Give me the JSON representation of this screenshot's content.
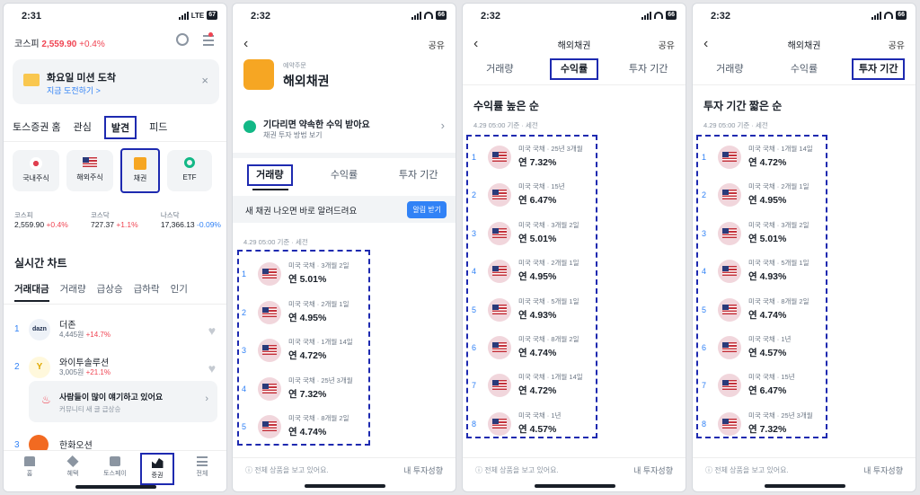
{
  "screen1": {
    "time": "2:31",
    "battery": "67",
    "kospi_label": "코스피",
    "kospi_value": "2,559.90",
    "kospi_change": "+0.4%",
    "mission_title": "화요일 미션 도착",
    "mission_link": "지금 도전하기 >",
    "mission_close": "×",
    "tabs": [
      "토스증권 홈",
      "관심",
      "발견",
      "피드"
    ],
    "categories": [
      {
        "label": "국내주식",
        "icon": "korea-flag-icon"
      },
      {
        "label": "해외주식",
        "icon": "us-flag-icon"
      },
      {
        "label": "채권",
        "icon": "bond-icon"
      },
      {
        "label": "ETF",
        "icon": "etf-icon"
      }
    ],
    "indices": [
      {
        "name": "코스피",
        "value": "2,559.90",
        "change": "+0.4%"
      },
      {
        "name": "코스닥",
        "value": "727.37",
        "change": "+1.1%"
      },
      {
        "name": "나스닥",
        "value": "17,366.13",
        "change": "-0.09%"
      }
    ],
    "chart_title": "실시간 차트",
    "chart_tabs": [
      "거래대금",
      "거래량",
      "급상승",
      "급하락",
      "인기"
    ],
    "stocks": [
      {
        "rank": "1",
        "name": "더존",
        "price": "4,445원",
        "change": "+14.7%",
        "logo": "dazn"
      },
      {
        "rank": "2",
        "name": "와이투솔루션",
        "price": "3,005원",
        "change": "+21.1%",
        "logo": "Y"
      },
      {
        "rank": "3",
        "name": "한화오션",
        "price": "",
        "change": "",
        "logo": ""
      }
    ],
    "promo_title": "사람들이 많이 얘기하고 있어요",
    "promo_sub": "커뮤니티 새 글 급상승",
    "bottom_nav": [
      "홈",
      "혜택",
      "토스페이",
      "증권",
      "전체"
    ]
  },
  "screen2": {
    "time": "2:32",
    "battery": "66",
    "share": "공유",
    "small_label": "예약주문",
    "title": "해외채권",
    "banner_title": "기다리면 약속한 수익 받아요",
    "banner_sub": "채권 투자 방법 보기",
    "tabs": [
      "거래량",
      "수익률",
      "투자 기간"
    ],
    "notify_text": "새 채권 나오면 바로 알려드려요",
    "notify_button": "알림 받기",
    "asof": "4.29 05:00 기준 · 세전",
    "rows": [
      {
        "num": "1",
        "desc": "미국 국채 · 3개월 2일",
        "rate": "연 5.01%"
      },
      {
        "num": "2",
        "desc": "미국 국채 · 2개월 1일",
        "rate": "연 4.95%"
      },
      {
        "num": "3",
        "desc": "미국 국채 · 1개월 14일",
        "rate": "연 4.72%"
      },
      {
        "num": "4",
        "desc": "미국 국채 · 25년 3개월",
        "rate": "연 7.32%"
      },
      {
        "num": "5",
        "desc": "미국 국채 · 8개월 2일",
        "rate": "연 4.74%"
      }
    ],
    "bottom_left": "ⓘ 전체 상품을 보고 있어요.",
    "bottom_right": "내 투자성향"
  },
  "screen3": {
    "time": "2:32",
    "battery": "66",
    "title": "해외채권",
    "share": "공유",
    "tabs": [
      "거래량",
      "수익률",
      "투자 기간"
    ],
    "heading": "수익률 높은 순",
    "asof": "4.29 05:00 기준 · 세전",
    "rows": [
      {
        "num": "1",
        "desc": "미국 국채 · 25년 3개월",
        "rate": "연 7.32%"
      },
      {
        "num": "2",
        "desc": "미국 국채 · 15년",
        "rate": "연 6.47%"
      },
      {
        "num": "3",
        "desc": "미국 국채 · 3개월 2일",
        "rate": "연 5.01%"
      },
      {
        "num": "4",
        "desc": "미국 국채 · 2개월 1일",
        "rate": "연 4.95%"
      },
      {
        "num": "5",
        "desc": "미국 국채 · 5개월 1일",
        "rate": "연 4.93%"
      },
      {
        "num": "6",
        "desc": "미국 국채 · 8개월 2일",
        "rate": "연 4.74%"
      },
      {
        "num": "7",
        "desc": "미국 국채 · 1개월 14일",
        "rate": "연 4.72%"
      },
      {
        "num": "8",
        "desc": "미국 국채 · 1년",
        "rate": "연 4.57%"
      }
    ],
    "bottom_left": "ⓘ 전체 상품을 보고 있어요.",
    "bottom_right": "내 투자성향"
  },
  "screen4": {
    "time": "2:32",
    "battery": "66",
    "title": "해외채권",
    "share": "공유",
    "tabs": [
      "거래량",
      "수익률",
      "투자 기간"
    ],
    "heading": "투자 기간 짧은 순",
    "asof": "4.29 05:00 기준 · 세전",
    "rows": [
      {
        "num": "1",
        "desc": "미국 국채 · 1개월 14일",
        "rate": "연 4.72%"
      },
      {
        "num": "2",
        "desc": "미국 국채 · 2개월 1일",
        "rate": "연 4.95%"
      },
      {
        "num": "3",
        "desc": "미국 국채 · 3개월 2일",
        "rate": "연 5.01%"
      },
      {
        "num": "4",
        "desc": "미국 국채 · 5개월 1일",
        "rate": "연 4.93%"
      },
      {
        "num": "5",
        "desc": "미국 국채 · 8개월 2일",
        "rate": "연 4.74%"
      },
      {
        "num": "6",
        "desc": "미국 국채 · 1년",
        "rate": "연 4.57%"
      },
      {
        "num": "7",
        "desc": "미국 국채 · 15년",
        "rate": "연 6.47%"
      },
      {
        "num": "8",
        "desc": "미국 국채 · 25년 3개월",
        "rate": "연 7.32%"
      }
    ],
    "bottom_left": "ⓘ 전체 상품을 보고 있어요.",
    "bottom_right": "내 투자성향"
  },
  "colors": {
    "up": "#f04452",
    "down": "#3182f6",
    "highlight": "#1e2ab0",
    "accent": "#3182f6"
  }
}
